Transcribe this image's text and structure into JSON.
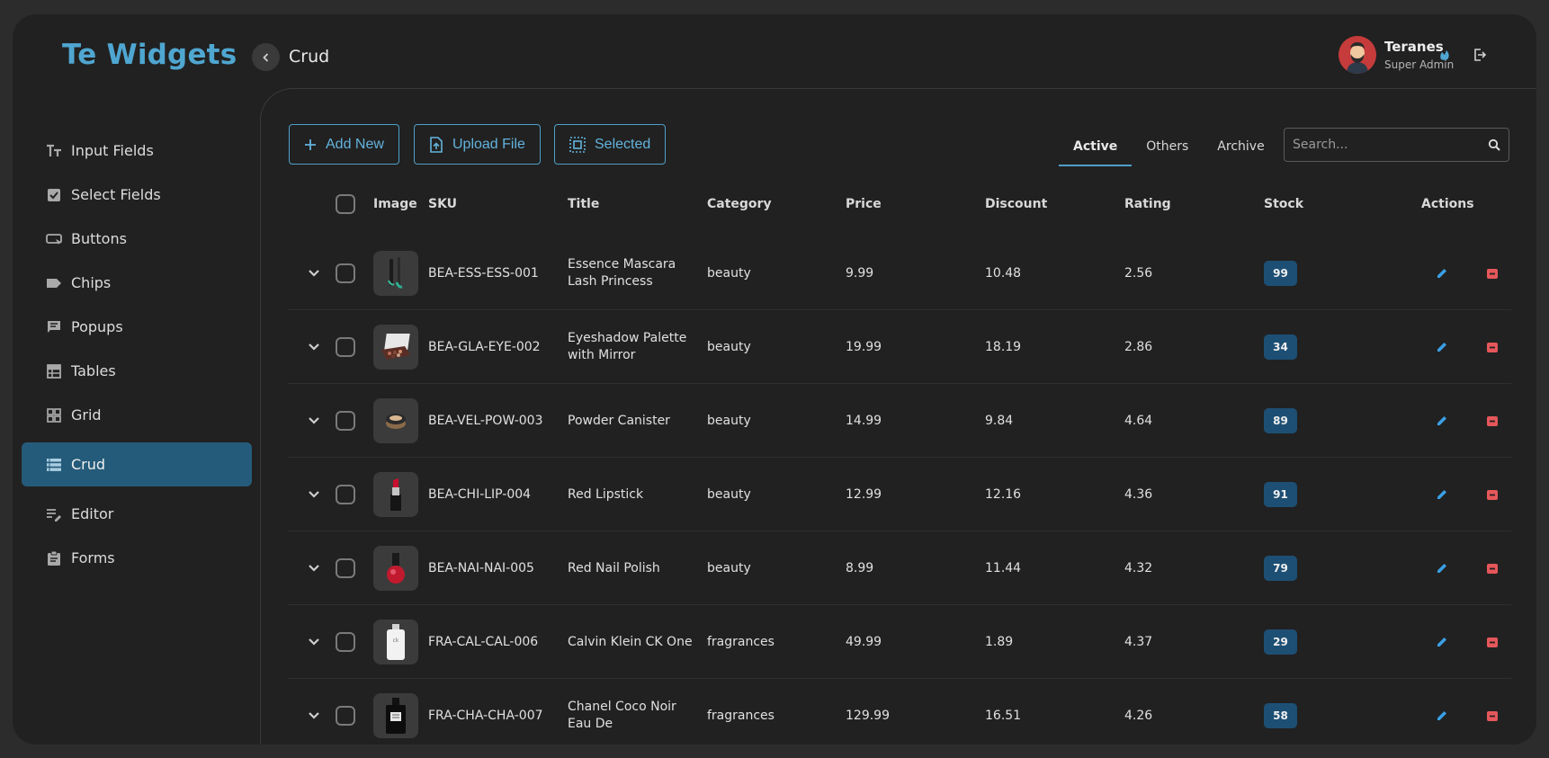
{
  "brand": "Te Widgets",
  "header": {
    "title": "Crud",
    "user": {
      "name": "Teranes",
      "role": "Super Admin"
    }
  },
  "sidebar": {
    "items": [
      {
        "label": "Input Fields",
        "icon": "text-format-icon"
      },
      {
        "label": "Select Fields",
        "icon": "checkbox-icon"
      },
      {
        "label": "Buttons",
        "icon": "button-icon"
      },
      {
        "label": "Chips",
        "icon": "label-tag-icon"
      },
      {
        "label": "Popups",
        "icon": "chat-bubble-icon"
      },
      {
        "label": "Tables",
        "icon": "table-icon"
      },
      {
        "label": "Grid",
        "icon": "grid-icon"
      },
      {
        "label": "Crud",
        "icon": "list-icon",
        "active": true
      },
      {
        "label": "Editor",
        "icon": "edit-notes-icon"
      },
      {
        "label": "Forms",
        "icon": "clipboard-icon"
      }
    ]
  },
  "toolbar": {
    "add_label": "Add New",
    "upload_label": "Upload File",
    "selected_label": "Selected",
    "tabs": [
      "Active",
      "Others",
      "Archive"
    ],
    "active_tab": "Active",
    "search_placeholder": "Search..."
  },
  "table": {
    "headers": {
      "image": "Image",
      "sku": "SKU",
      "title": "Title",
      "category": "Category",
      "price": "Price",
      "discount": "Discount",
      "rating": "Rating",
      "stock": "Stock",
      "actions": "Actions"
    },
    "rows": [
      {
        "sku": "BEA-ESS-ESS-001",
        "title": "Essence Mascara Lash Princess",
        "category": "beauty",
        "price": "9.99",
        "discount": "10.48",
        "rating": "2.56",
        "stock": "99",
        "thumb": "mascara"
      },
      {
        "sku": "BEA-GLA-EYE-002",
        "title": "Eyeshadow Palette with Mirror",
        "category": "beauty",
        "price": "19.99",
        "discount": "18.19",
        "rating": "2.86",
        "stock": "34",
        "thumb": "palette"
      },
      {
        "sku": "BEA-VEL-POW-003",
        "title": "Powder Canister",
        "category": "beauty",
        "price": "14.99",
        "discount": "9.84",
        "rating": "4.64",
        "stock": "89",
        "thumb": "powder"
      },
      {
        "sku": "BEA-CHI-LIP-004",
        "title": "Red Lipstick",
        "category": "beauty",
        "price": "12.99",
        "discount": "12.16",
        "rating": "4.36",
        "stock": "91",
        "thumb": "lipstick"
      },
      {
        "sku": "BEA-NAI-NAI-005",
        "title": "Red Nail Polish",
        "category": "beauty",
        "price": "8.99",
        "discount": "11.44",
        "rating": "4.32",
        "stock": "79",
        "thumb": "nailpolish"
      },
      {
        "sku": "FRA-CAL-CAL-006",
        "title": "Calvin Klein CK One",
        "category": "fragrances",
        "price": "49.99",
        "discount": "1.89",
        "rating": "4.37",
        "stock": "29",
        "thumb": "ckone"
      },
      {
        "sku": "FRA-CHA-CHA-007",
        "title": "Chanel Coco Noir Eau De",
        "category": "fragrances",
        "price": "129.99",
        "discount": "16.51",
        "rating": "4.26",
        "stock": "58",
        "thumb": "chanel"
      }
    ]
  },
  "colors": {
    "accent": "#4fa6d1",
    "active_nav": "#255b7a",
    "badge": "#1d4f74",
    "delete": "#e5575a",
    "edit": "#3aa0e6"
  }
}
